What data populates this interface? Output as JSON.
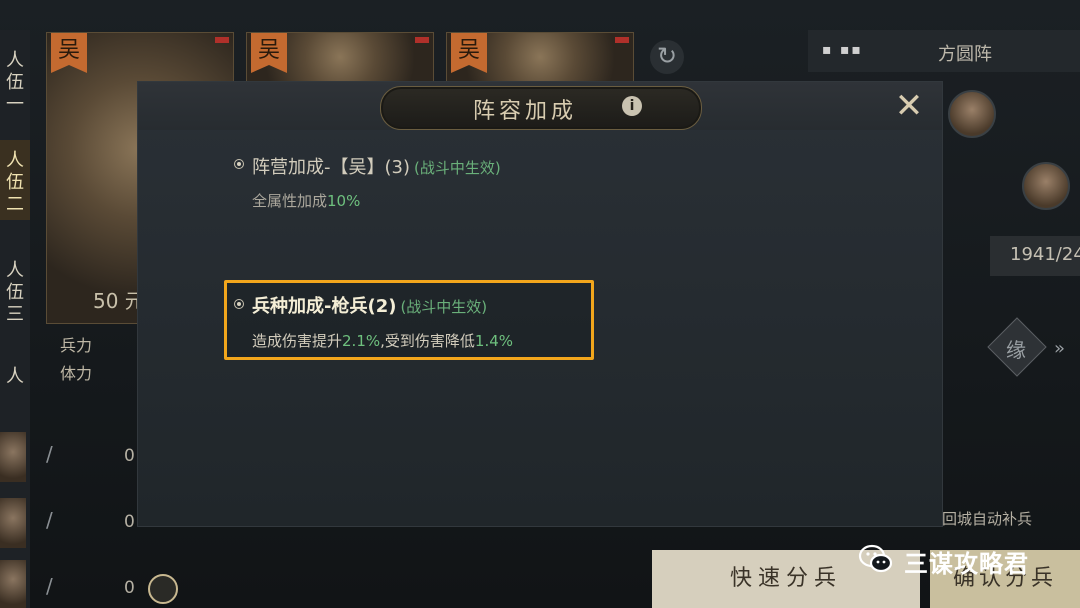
{
  "background": {
    "left_tabs": [
      "人\n伍\n一",
      "人\n伍\n二",
      "人\n伍\n三",
      "人"
    ],
    "cards": [
      {
        "faction": "吴",
        "level": "50 元"
      },
      {
        "faction": "吴",
        "level": ""
      },
      {
        "faction": "吴",
        "level": ""
      }
    ],
    "formation_label": "方圆阵",
    "troop_labels": [
      "兵力",
      "体力"
    ],
    "troop_count": "1941/24",
    "diamond_label": "缘",
    "row_values": [
      "0",
      "0",
      "0"
    ],
    "auto_refill_label": "回城自动补兵",
    "quick_button": "快速分兵",
    "confirm_button": "确认分兵"
  },
  "modal": {
    "title": "阵容加成",
    "bonuses": [
      {
        "title": "阵营加成-【吴】(3)",
        "note": "(战斗中生效)",
        "desc_prefix": "全属性加成",
        "desc_value": "10%",
        "highlighted": false
      },
      {
        "title": "兵种加成-枪兵(2)",
        "note": "(战斗中生效)",
        "desc_prefix": "造成伤害提升",
        "desc_value": "2.1%",
        "desc_mid": ",受到伤害降低",
        "desc_value2": "1.4%",
        "highlighted": true
      }
    ]
  },
  "watermark": {
    "text": "三谋攻略君",
    "icon": "wechat-icon"
  },
  "colors": {
    "highlight": "#f2a61c",
    "green_value": "#6ec07e",
    "faction_flag": "#c46a30"
  }
}
